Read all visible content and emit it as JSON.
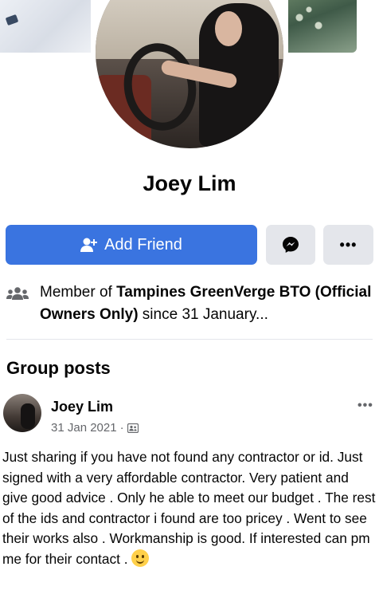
{
  "profile": {
    "name": "Joey Lim"
  },
  "actions": {
    "add_friend_label": "Add Friend",
    "messenger_icon": "messenger-icon",
    "more_label": "•••"
  },
  "membership": {
    "prefix": "Member of ",
    "group_name": "Tampines GreenVerge BTO (Official Owners Only)",
    "suffix": " since 31 January..."
  },
  "group_posts": {
    "title": "Group posts",
    "posts": [
      {
        "author": "Joey Lim",
        "date": "31 Jan 2021",
        "separator": "·",
        "privacy_icon": "members-only-icon",
        "options_label": "•••",
        "text": "Just sharing if you have not found any contractor or id. Just signed with a very affordable contractor. Very patient and give good advice . Only he able to meet our budget . The rest of the ids and contractor i found are too pricey . Went to see their works also . Workmanship is good. If interested can pm me for their contact ."
      }
    ]
  },
  "colors": {
    "primary_blue": "#3a74e0",
    "secondary_button": "#e4e6eb",
    "muted_text": "#65676b"
  }
}
